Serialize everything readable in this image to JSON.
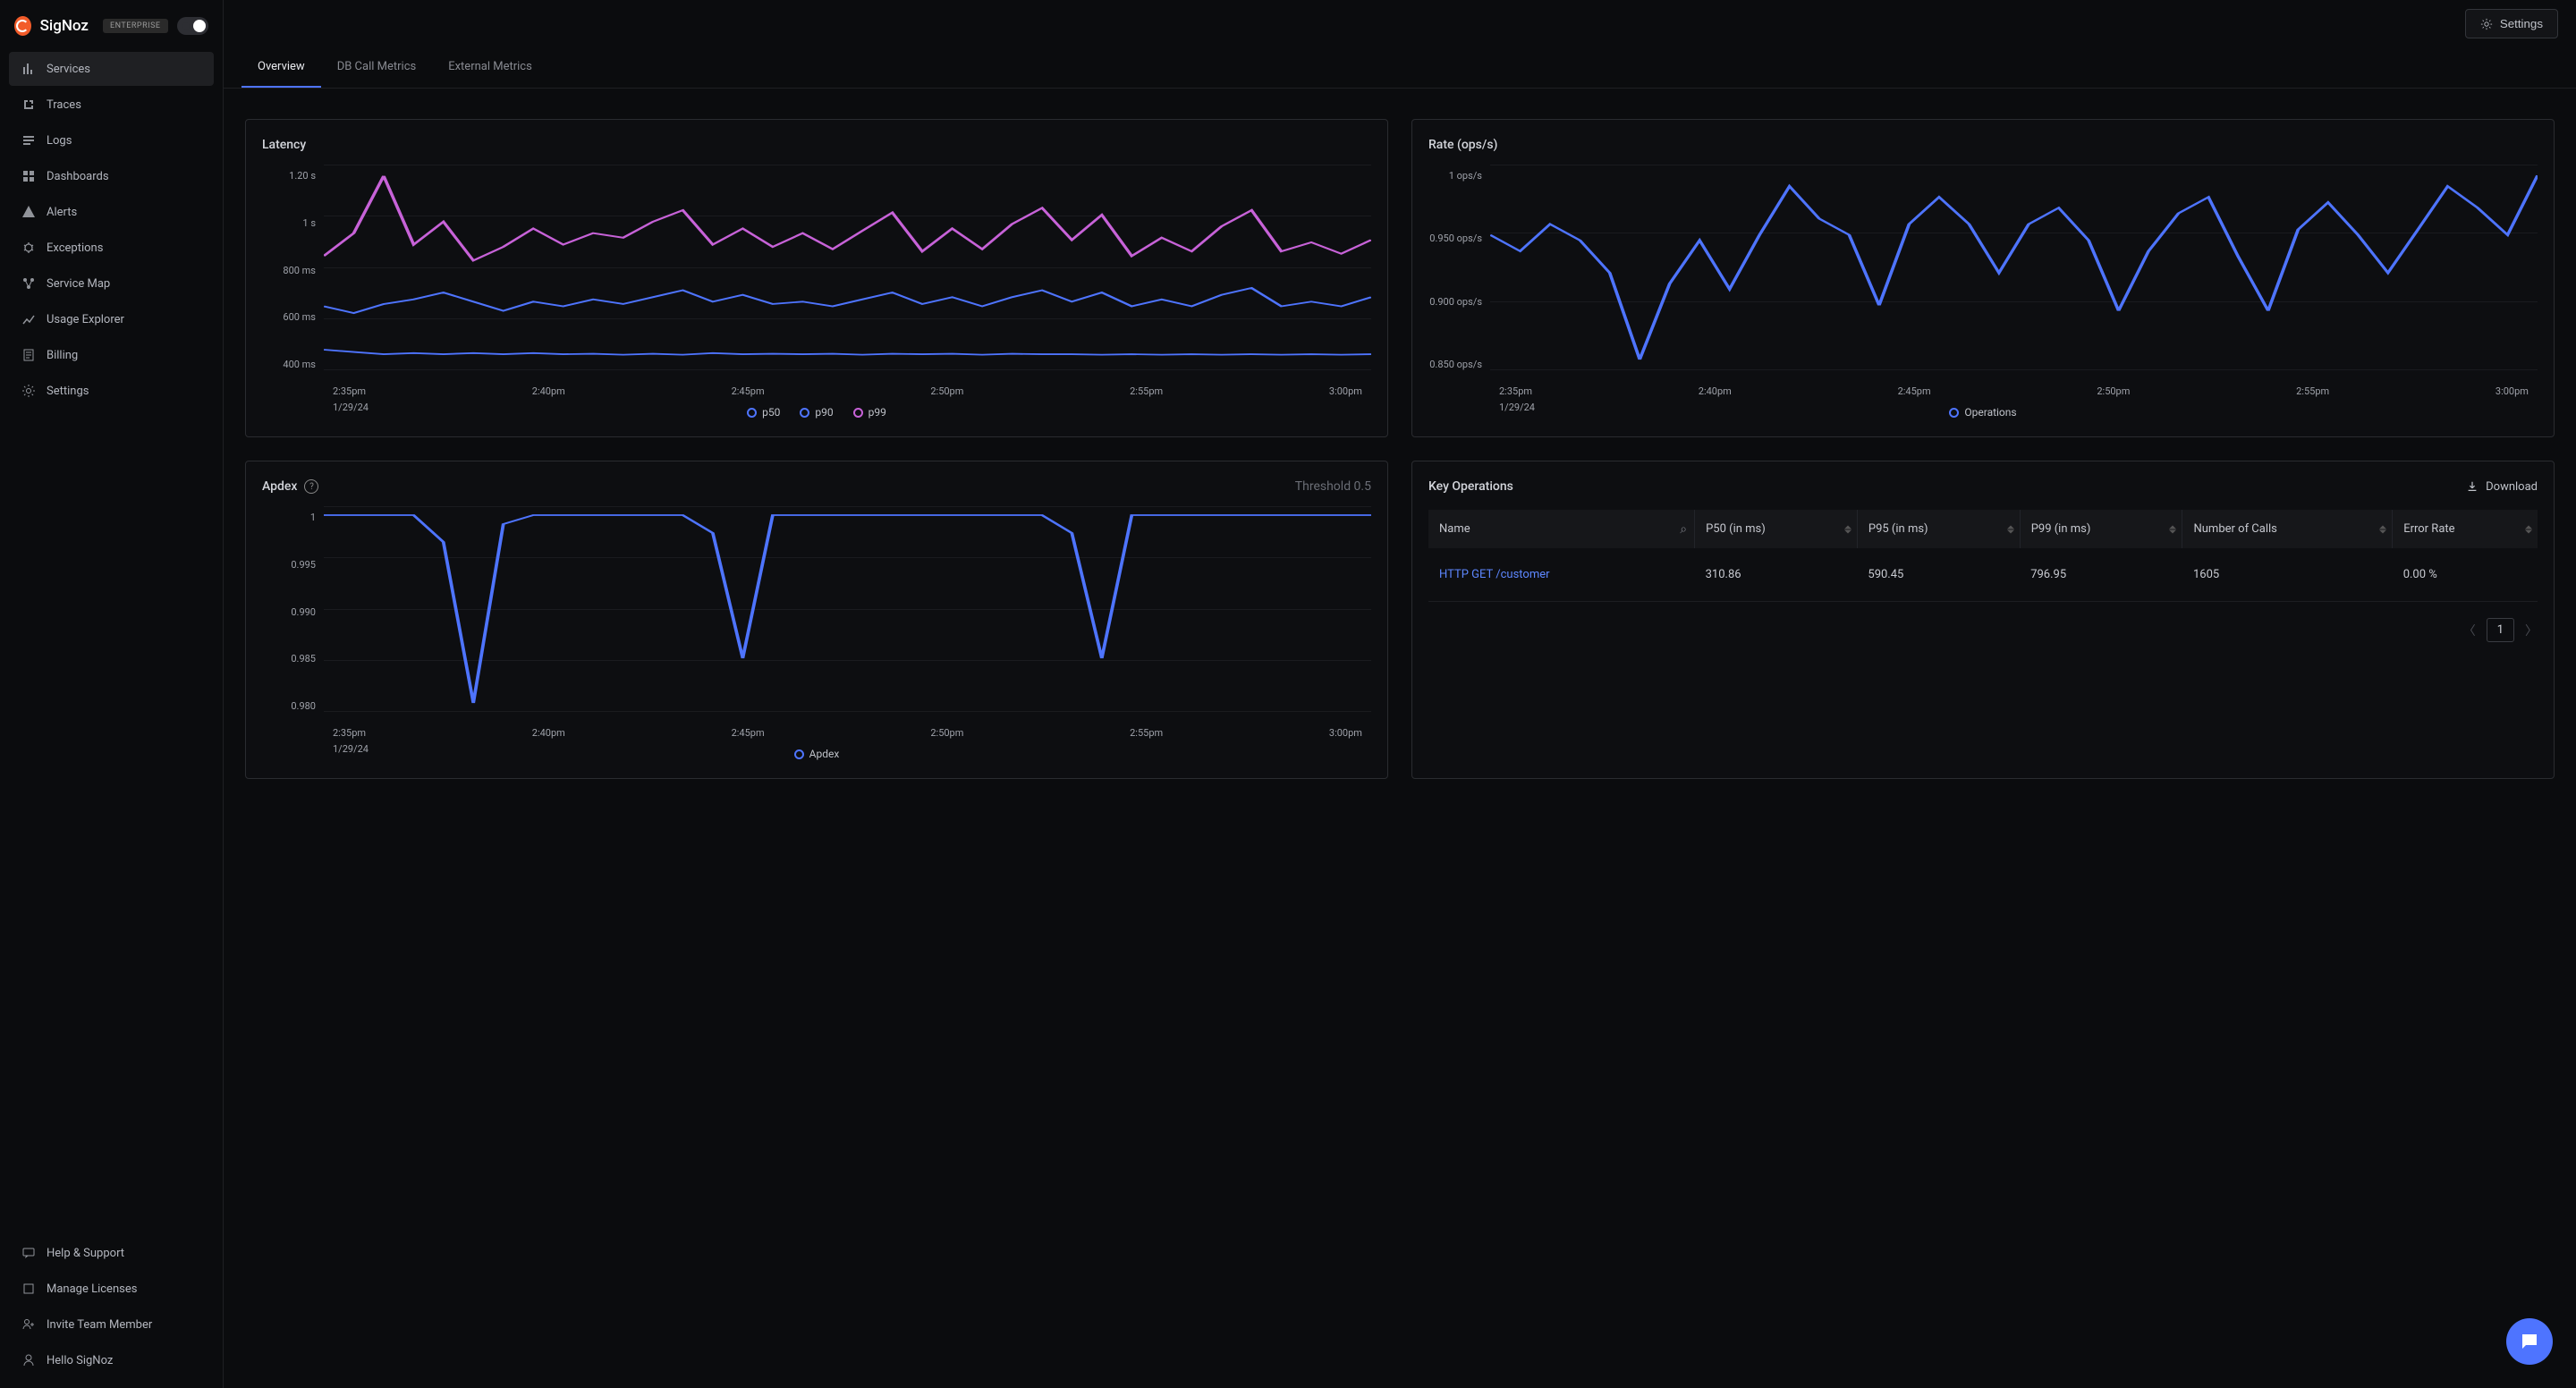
{
  "brand": "SigNoz",
  "badge": "ENTERPRISE",
  "top_settings": "Settings",
  "nav": [
    {
      "label": "Services",
      "icon": "bar"
    },
    {
      "label": "Traces",
      "icon": "flow"
    },
    {
      "label": "Logs",
      "icon": "list"
    },
    {
      "label": "Dashboards",
      "icon": "grid"
    },
    {
      "label": "Alerts",
      "icon": "alert"
    },
    {
      "label": "Exceptions",
      "icon": "bug"
    },
    {
      "label": "Service Map",
      "icon": "map"
    },
    {
      "label": "Usage Explorer",
      "icon": "chart"
    },
    {
      "label": "Billing",
      "icon": "receipt"
    },
    {
      "label": "Settings",
      "icon": "gear"
    }
  ],
  "nav_bottom": [
    {
      "label": "Help & Support"
    },
    {
      "label": "Manage Licenses"
    },
    {
      "label": "Invite Team Member"
    },
    {
      "label": "Hello SigNoz"
    }
  ],
  "tabs": [
    "Overview",
    "DB Call Metrics",
    "External Metrics"
  ],
  "panels": {
    "latency": {
      "title": "Latency"
    },
    "rate": {
      "title": "Rate (ops/s)"
    },
    "apdex": {
      "title": "Apdex",
      "threshold": "Threshold 0.5"
    },
    "keyops": {
      "title": "Key Operations",
      "download": "Download"
    }
  },
  "legend_latency": [
    "p50",
    "p90",
    "p99"
  ],
  "legend_rate": [
    "Operations"
  ],
  "legend_apdex": [
    "Apdex"
  ],
  "table": {
    "cols": [
      "Name",
      "P50 (in ms)",
      "P95 (in ms)",
      "P99 (in ms)",
      "Number of Calls",
      "Error Rate"
    ],
    "row": {
      "name": "HTTP GET /customer",
      "p50": "310.86",
      "p95": "590.45",
      "p99": "796.95",
      "calls": "1605",
      "err": "0.00 %"
    }
  },
  "page": "1",
  "chart_data": [
    {
      "id": "latency",
      "type": "line",
      "title": "Latency",
      "x": [
        "2:35pm",
        "2:40pm",
        "2:45pm",
        "2:50pm",
        "2:55pm",
        "3:00pm"
      ],
      "xdate": "1/29/24",
      "yticks": [
        "1.20 s",
        "1 s",
        "800 ms",
        "600 ms",
        "400 ms"
      ],
      "ylim": [
        300,
        1200
      ],
      "series": [
        {
          "name": "p50",
          "color": "#4e74ff",
          "values": [
            390,
            380,
            370,
            375,
            370,
            375,
            370,
            375,
            370,
            372,
            368,
            372,
            368,
            375,
            370,
            372,
            370,
            372,
            368,
            372,
            370,
            372,
            368,
            372,
            370,
            370,
            368,
            370,
            368,
            370,
            368,
            370,
            368,
            370,
            368,
            370
          ]
        },
        {
          "name": "p90",
          "color": "#4e74ff",
          "values": [
            580,
            550,
            590,
            610,
            640,
            600,
            560,
            600,
            580,
            610,
            590,
            620,
            650,
            600,
            630,
            590,
            600,
            580,
            610,
            640,
            590,
            620,
            580,
            620,
            650,
            600,
            640,
            580,
            610,
            580,
            630,
            660,
            580,
            600,
            580,
            620
          ]
        },
        {
          "name": "p99",
          "color": "#c762d8",
          "values": [
            800,
            900,
            1150,
            850,
            950,
            780,
            840,
            920,
            850,
            900,
            880,
            950,
            1000,
            850,
            920,
            840,
            900,
            830,
            910,
            990,
            820,
            920,
            830,
            940,
            1010,
            870,
            980,
            800,
            880,
            820,
            930,
            1000,
            820,
            860,
            810,
            870
          ]
        }
      ]
    },
    {
      "id": "rate",
      "type": "line",
      "title": "Rate (ops/s)",
      "x": [
        "2:35pm",
        "2:40pm",
        "2:45pm",
        "2:50pm",
        "2:55pm",
        "3:00pm"
      ],
      "xdate": "1/29/24",
      "yticks": [
        "1 ops/s",
        "0.950 ops/s",
        "0.900 ops/s",
        "0.850 ops/s"
      ],
      "ylim": [
        0.83,
        1.02
      ],
      "series": [
        {
          "name": "Operations",
          "color": "#4e74ff",
          "values": [
            0.955,
            0.94,
            0.965,
            0.95,
            0.92,
            0.84,
            0.91,
            0.95,
            0.905,
            0.955,
            1.0,
            0.97,
            0.955,
            0.89,
            0.965,
            0.99,
            0.965,
            0.92,
            0.965,
            0.98,
            0.95,
            0.885,
            0.94,
            0.975,
            0.99,
            0.935,
            0.885,
            0.96,
            0.985,
            0.955,
            0.92,
            0.96,
            1.0,
            0.98,
            0.955,
            1.01
          ]
        }
      ]
    },
    {
      "id": "apdex",
      "type": "line",
      "title": "Apdex",
      "x": [
        "2:35pm",
        "2:40pm",
        "2:45pm",
        "2:50pm",
        "2:55pm",
        "3:00pm"
      ],
      "xdate": "1/29/24",
      "yticks": [
        "1",
        "0.995",
        "0.990",
        "0.985",
        "0.980"
      ],
      "ylim": [
        0.978,
        1.001
      ],
      "series": [
        {
          "name": "Apdex",
          "color": "#4e74ff",
          "values": [
            1,
            1,
            1,
            1,
            0.997,
            0.979,
            0.999,
            1,
            1,
            1,
            1,
            1,
            1,
            0.998,
            0.984,
            1,
            1,
            1,
            1,
            1,
            1,
            1,
            1,
            1,
            1,
            0.998,
            0.984,
            1,
            1,
            1,
            1,
            1,
            1,
            1,
            1,
            1
          ]
        }
      ]
    }
  ]
}
